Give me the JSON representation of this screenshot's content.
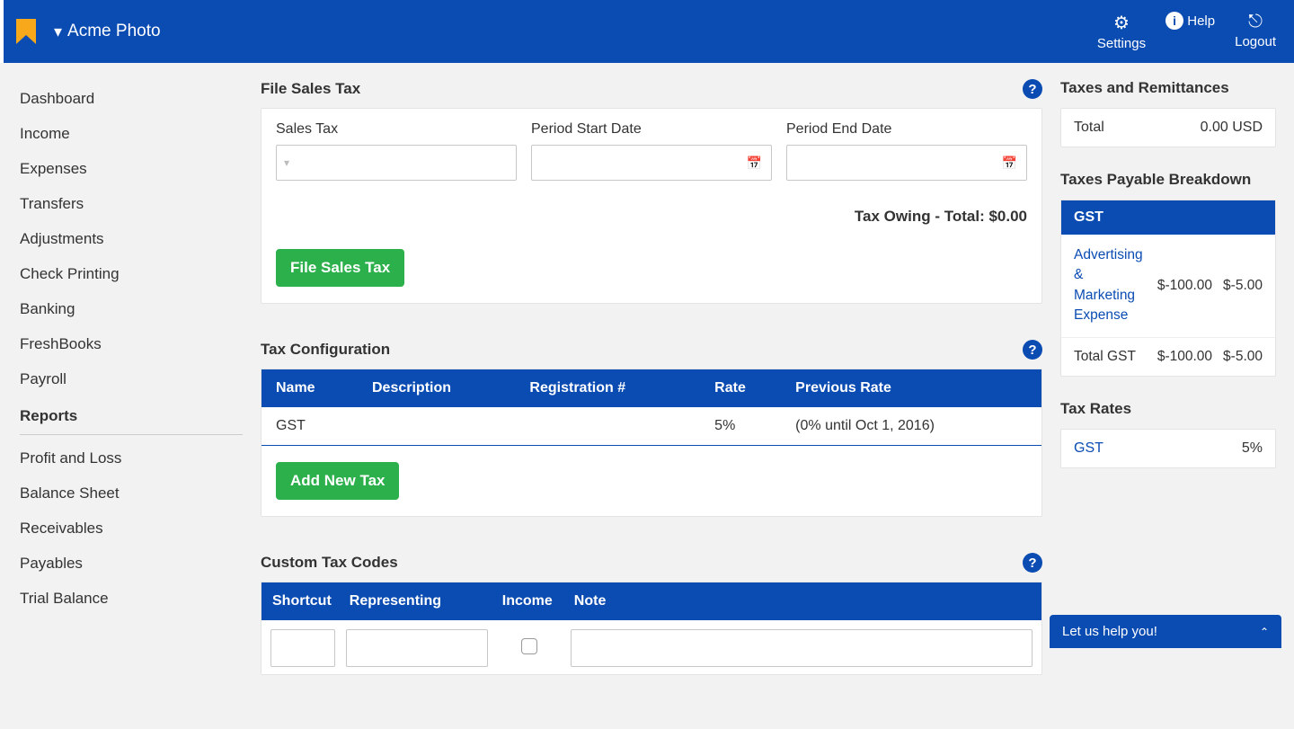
{
  "header": {
    "org_name": "Acme Photo",
    "actions": {
      "settings": "Settings",
      "help": "Help",
      "logout": "Logout"
    }
  },
  "sidebar": {
    "main_items": [
      "Dashboard",
      "Income",
      "Expenses",
      "Transfers",
      "Adjustments",
      "Check Printing",
      "Banking",
      "FreshBooks",
      "Payroll"
    ],
    "reports_header": "Reports",
    "report_items": [
      "Profit and Loss",
      "Balance Sheet",
      "Receivables",
      "Payables",
      "Trial Balance"
    ]
  },
  "file_sales_tax": {
    "title": "File Sales Tax",
    "labels": {
      "sales_tax": "Sales Tax",
      "period_start": "Period Start Date",
      "period_end": "Period End Date"
    },
    "tax_owing_text": "Tax Owing - Total: $0.00",
    "button": "File Sales Tax"
  },
  "tax_config": {
    "title": "Tax Configuration",
    "columns": [
      "Name",
      "Description",
      "Registration #",
      "Rate",
      "Previous Rate"
    ],
    "rows": [
      {
        "name": "GST",
        "description": "",
        "registration": "",
        "rate": "5%",
        "previous_rate": "(0% until Oct 1, 2016)"
      }
    ],
    "add_button": "Add New Tax"
  },
  "custom_codes": {
    "title": "Custom Tax Codes",
    "columns": [
      "Shortcut",
      "Representing",
      "Income",
      "Note"
    ]
  },
  "right_rail": {
    "remittances": {
      "title": "Taxes and Remittances",
      "total_label": "Total",
      "total_value": "0.00 USD"
    },
    "payable": {
      "title": "Taxes Payable Breakdown",
      "band": "GST",
      "rows": [
        {
          "label": "Advertising & Marketing Expense",
          "amount": "$-100.00",
          "tax": "$-5.00",
          "is_link": true
        },
        {
          "label": "Total GST",
          "amount": "$-100.00",
          "tax": "$-5.00",
          "is_link": false
        }
      ]
    },
    "rates": {
      "title": "Tax Rates",
      "rows": [
        {
          "name": "GST",
          "rate": "5%"
        }
      ]
    }
  },
  "help_bar": "Let us help you!"
}
